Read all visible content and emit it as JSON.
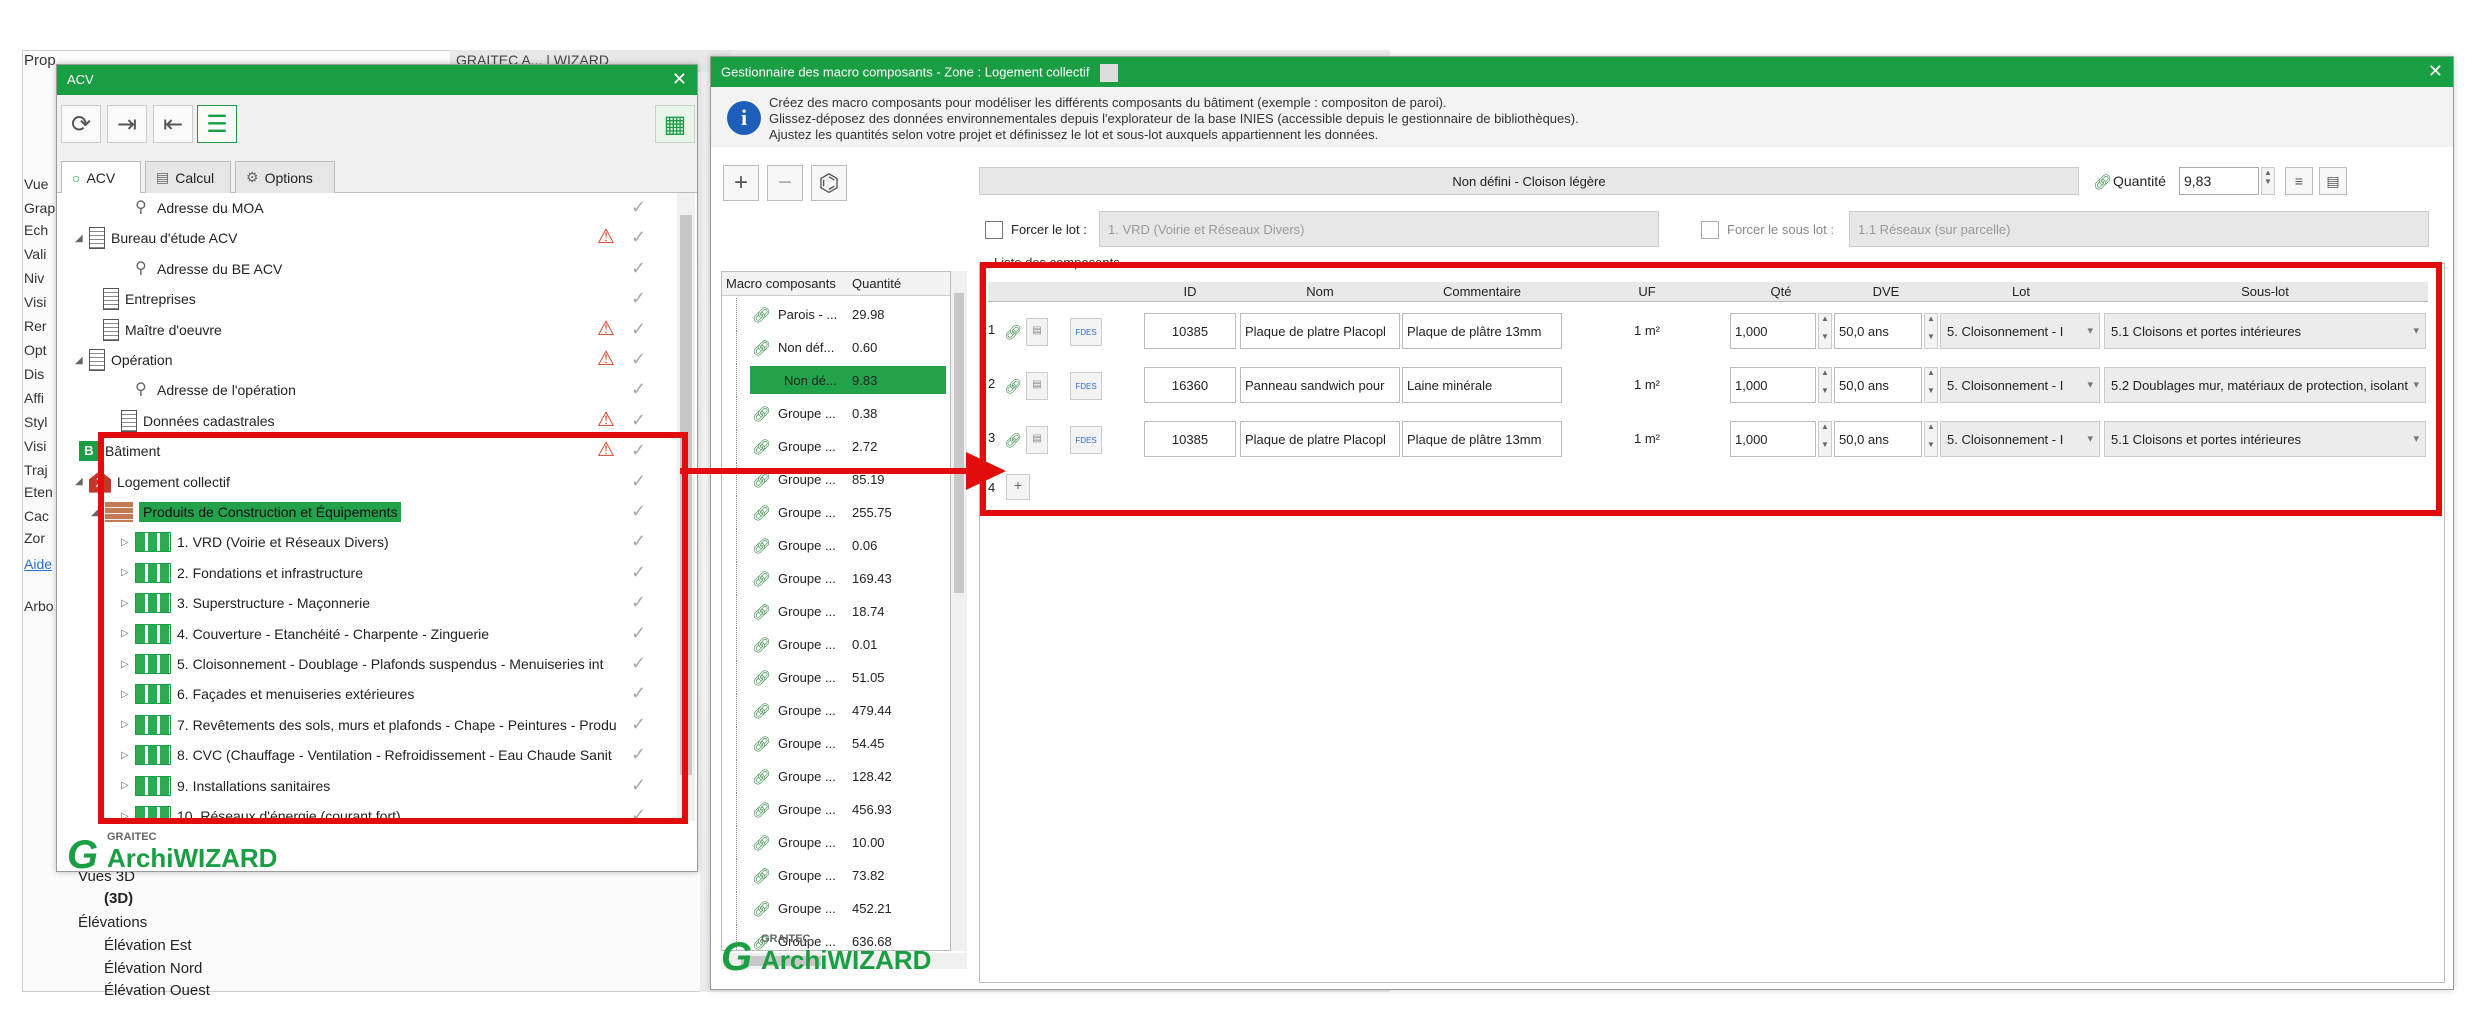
{
  "background": {
    "props_title": "Prop",
    "tab_title": "GRAITEC A... | WIZARD",
    "side_labels": [
      "Vue",
      "Grap",
      "Ech",
      "Vali",
      "Niv",
      "Visi",
      "Rer",
      "Opt",
      "Dis",
      "Affi",
      "Styl",
      "Visi",
      "Traj",
      "Eten",
      "Cac",
      "Zor",
      "Aide",
      "Arbo"
    ],
    "tree": {
      "vues3d": "Vues 3D",
      "view3d": "(3D)",
      "elevations": "Élévations",
      "est": "Élévation Est",
      "nord": "Élévation Nord",
      "ouest": "Élévation Ouest"
    }
  },
  "acv": {
    "title": "ACV",
    "tabs": [
      {
        "label": "ACV"
      },
      {
        "label": "Calcul"
      },
      {
        "label": "Options"
      }
    ],
    "tree": [
      {
        "label": "Adresse du MOA"
      },
      {
        "label": "Bureau d'étude ACV"
      },
      {
        "label": "Adresse du BE ACV"
      },
      {
        "label": "Entreprises"
      },
      {
        "label": "Maître d'oeuvre"
      },
      {
        "label": "Opération"
      },
      {
        "label": "Adresse de l'opération"
      },
      {
        "label": "Données cadastrales"
      },
      {
        "label": "Bâtiment"
      },
      {
        "label": "Logement collectif"
      },
      {
        "label": "Produits de Construction et Équipements"
      },
      {
        "label": "1. VRD (Voirie et Réseaux Divers)"
      },
      {
        "label": "2. Fondations et infrastructure"
      },
      {
        "label": "3. Superstructure - Maçonnerie"
      },
      {
        "label": "4. Couverture - Etanchéité - Charpente - Zinguerie"
      },
      {
        "label": "5. Cloisonnement - Doublage - Plafonds suspendus - Menuiseries int"
      },
      {
        "label": "6. Façades et menuiseries extérieures"
      },
      {
        "label": "7. Revêtements des sols, murs et plafonds - Chape - Peintures - Produ"
      },
      {
        "label": "8. CVC (Chauffage - Ventilation - Refroidissement - Eau Chaude Sanit"
      },
      {
        "label": "9. Installations sanitaires"
      },
      {
        "label": "10. Réseaux d'énergie (courant fort)"
      }
    ],
    "logo_small": "GRAITEC",
    "logo_big": "ArchiWIZARD"
  },
  "manager": {
    "title": "Gestionnaire des macro composants - Zone : Logement collectif",
    "info": [
      "Créez des macro composants pour modéliser les différents composants du bâtiment (exemple : compositon de paroi).",
      "Glissez-déposez des données environnementales depuis l'explorateur de la base INIES (accessible depuis le gestionnaire de bibliothèques).",
      "Ajustez les quantités selon votre projet et définissez le lot et sous-lot auxquels appartiennent les données."
    ],
    "macro_headers": {
      "name": "Macro composants",
      "qty": "Quantité"
    },
    "macros": [
      {
        "name": "Parois - ...",
        "qty": "29.98"
      },
      {
        "name": "Non déf...",
        "qty": "0.60"
      },
      {
        "name": "Non dé...",
        "qty": "9.83"
      },
      {
        "name": "Groupe ...",
        "qty": "0.38"
      },
      {
        "name": "Groupe ...",
        "qty": "2.72"
      },
      {
        "name": "Groupe ...",
        "qty": "85.19"
      },
      {
        "name": "Groupe ...",
        "qty": "255.75"
      },
      {
        "name": "Groupe ...",
        "qty": "0.06"
      },
      {
        "name": "Groupe ...",
        "qty": "169.43"
      },
      {
        "name": "Groupe ...",
        "qty": "18.74"
      },
      {
        "name": "Groupe ...",
        "qty": "0.01"
      },
      {
        "name": "Groupe ...",
        "qty": "51.05"
      },
      {
        "name": "Groupe ...",
        "qty": "479.44"
      },
      {
        "name": "Groupe ...",
        "qty": "54.45"
      },
      {
        "name": "Groupe ...",
        "qty": "128.42"
      },
      {
        "name": "Groupe ...",
        "qty": "456.93"
      },
      {
        "name": "Groupe ...",
        "qty": "10.00"
      },
      {
        "name": "Groupe ...",
        "qty": "73.82"
      },
      {
        "name": "Groupe ...",
        "qty": "452.21"
      },
      {
        "name": "Groupe ...",
        "qty": "636.68"
      }
    ],
    "selected_name": "Non défini - Cloison légère",
    "qty_label": "Quantité",
    "qty_value": "9,83",
    "force_lot_label": "Forcer le lot :",
    "force_lot_value": "1. VRD (Voirie et Réseaux Divers)",
    "force_sous_lot_label": "Forcer le sous lot :",
    "force_sous_lot_value": "1.1 Réseaux (sur parcelle)",
    "list_title": "Liste des composants",
    "columns": [
      "ID",
      "Nom",
      "Commentaire",
      "UF",
      "Qté",
      "DVE",
      "Lot",
      "Sous-lot"
    ],
    "rows": [
      {
        "num": "1",
        "id": "10385",
        "nom": "Plaque de platre Placopl",
        "comment": "Plaque de plâtre 13mm",
        "uf": "1 m²",
        "qte": "1,000",
        "dve": "50,0 ans",
        "lot": "5. Cloisonnement - I",
        "sous_lot": "5.1 Cloisons et portes intérieures"
      },
      {
        "num": "2",
        "id": "16360",
        "nom": "Panneau sandwich pour",
        "comment": "Laine minérale",
        "uf": "1 m²",
        "qte": "1,000",
        "dve": "50,0 ans",
        "lot": "5. Cloisonnement - I",
        "sous_lot": "5.2 Doublages mur, matériaux de protection, isolant"
      },
      {
        "num": "3",
        "id": "10385",
        "nom": "Plaque de platre Placopl",
        "comment": "Plaque de plâtre 13mm",
        "uf": "1 m²",
        "qte": "1,000",
        "dve": "50,0 ans",
        "lot": "5. Cloisonnement - I",
        "sous_lot": "5.1 Cloisons et portes intérieures"
      }
    ],
    "add_row_num": "4",
    "add_label": "+",
    "logo_small": "GRAITEC",
    "logo_big": "ArchiWIZARD"
  },
  "colors": {
    "brand_green": "#1a9e43",
    "highlight_red": "#e10d0d",
    "warning": "#d9401f"
  }
}
